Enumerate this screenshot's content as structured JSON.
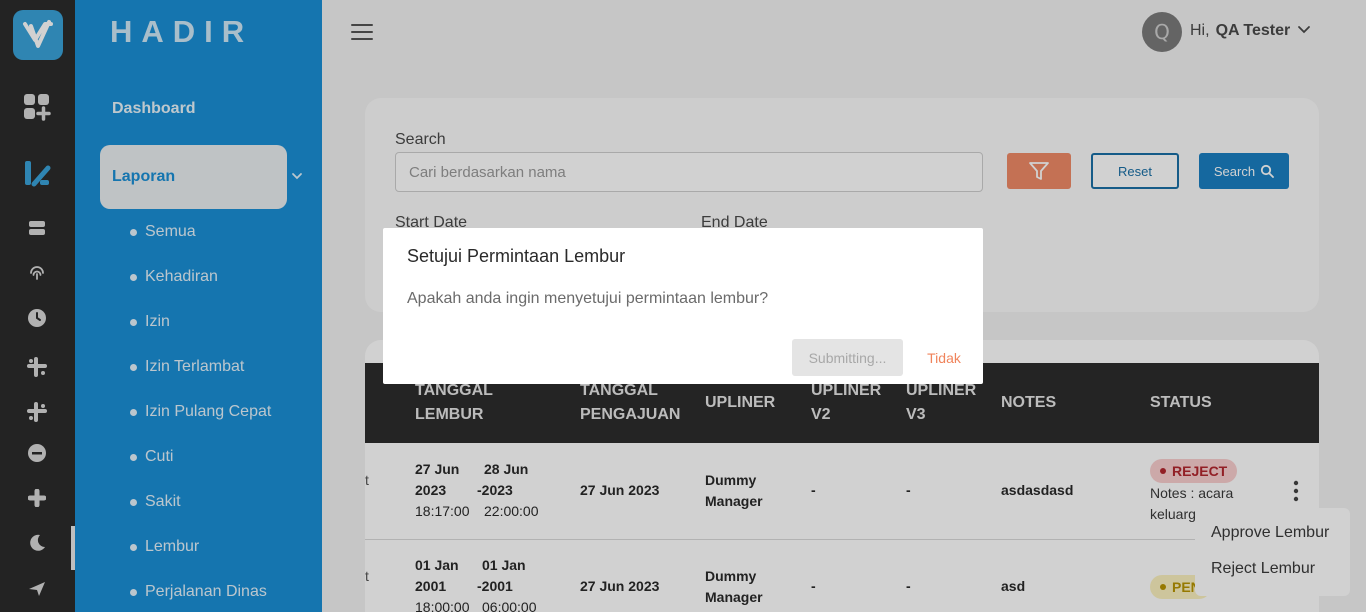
{
  "app": {
    "brand": "HADIR"
  },
  "colors": {
    "sidebar": "#1a8fd6",
    "rail": "#2b2b2b",
    "accent_orange": "#f08a67",
    "primary_blue": "#1a7fc2",
    "reject_badge": "#f9cfcf",
    "pending_badge": "#fbf1bf"
  },
  "rail_icons": [
    "logo-icon",
    "dashboard-grid-icon",
    "report-icon",
    "server-icon",
    "fingerprint-icon",
    "clock-icon",
    "slack-icon",
    "slack-icon",
    "minus-circle-icon",
    "plus-icon",
    "moon-icon",
    "plane-icon"
  ],
  "sidebar": {
    "dashboard": "Dashboard",
    "laporan": "Laporan",
    "items": [
      {
        "label": "Semua"
      },
      {
        "label": "Kehadiran"
      },
      {
        "label": "Izin"
      },
      {
        "label": "Izin Terlambat"
      },
      {
        "label": "Izin Pulang Cepat"
      },
      {
        "label": "Cuti"
      },
      {
        "label": "Sakit"
      },
      {
        "label": "Lembur"
      },
      {
        "label": "Perjalanan Dinas"
      }
    ]
  },
  "header": {
    "avatar_letter": "Q",
    "greeting": "Hi,",
    "user_name": "QA Tester"
  },
  "filters": {
    "search_label": "Search",
    "search_placeholder": "Cari berdasarkan nama",
    "start_date_label": "Start Date",
    "end_date_label": "End Date",
    "reset_label": "Reset",
    "search_button_label": "Search"
  },
  "table": {
    "headers": {
      "tanggal_lembur_1": "TANGGAL",
      "tanggal_lembur_2": "LEMBUR",
      "tanggal_pengajuan_1": "TANGGAL",
      "tanggal_pengajuan_2": "PENGAJUAN",
      "upliner": "UPLINER",
      "upliner_v2_1": "UPLINER",
      "upliner_v2_2": "V2",
      "upliner_v3_1": "UPLINER",
      "upliner_v3_2": "V3",
      "notes": "NOTES",
      "status": "STATUS"
    },
    "rows": [
      {
        "truncated": "t",
        "start_date_1": "27 Jun",
        "start_date_2": "2023",
        "start_time": "18:17:00",
        "end_date_1": "28 Jun",
        "end_date_2": "-2023",
        "end_time": "22:00:00",
        "pengajuan": "27 Jun 2023",
        "upliner_1": "Dummy",
        "upliner_2": "Manager",
        "v2": "-",
        "v3": "-",
        "notes": "asdasdasd",
        "status": "REJECT",
        "status_note_1": "Notes : acara",
        "status_note_2": "keluarg"
      },
      {
        "truncated": "t",
        "start_date_1": "01 Jan",
        "start_date_2": "2001",
        "start_time": "18:00:00",
        "end_date_1": "01 Jan",
        "end_date_2": "-2001",
        "end_time": "06:00:00",
        "pengajuan": "27 Jun 2023",
        "upliner_1": "Dummy",
        "upliner_2": "Manager",
        "v2": "-",
        "v3": "-",
        "notes": "asd",
        "status": "PEN"
      }
    ]
  },
  "context_menu": {
    "approve": "Approve Lembur",
    "reject": "Reject Lembur"
  },
  "modal": {
    "title": "Setujui Permintaan Lembur",
    "message": "Apakah anda ingin menyetujui permintaan lembur?",
    "submit_label": "Submitting...",
    "cancel_label": "Tidak"
  }
}
